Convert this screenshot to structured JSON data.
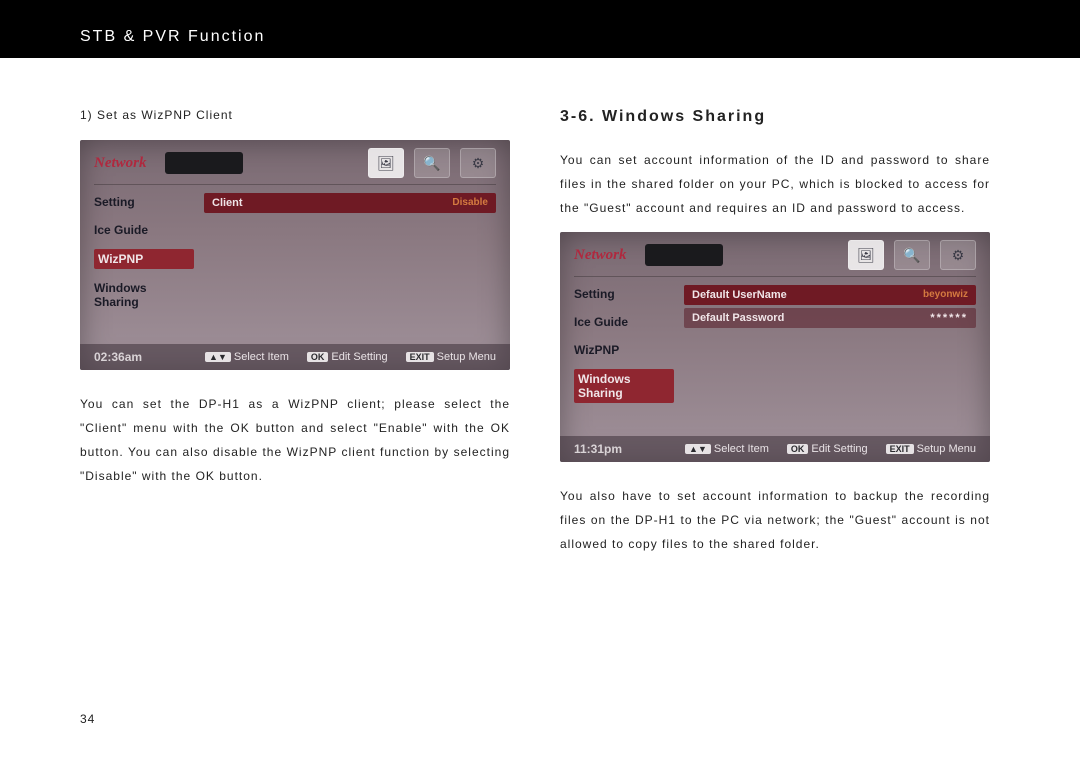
{
  "header": {
    "title": "STB & PVR Function"
  },
  "page_number": "34",
  "left": {
    "subhead": "1) Set as WizPNP Client",
    "body": "You can set the DP-H1 as a WizPNP client; please select the \"Client\" menu with the OK button and select \"Enable\" with the OK button. You can also disable the WizPNP client function by selecting \"Disable\" with the OK button.",
    "tv": {
      "logo": "Network",
      "sidebar": [
        "Setting",
        "Ice Guide",
        "WizPNP",
        "Windows Sharing"
      ],
      "selected_side_index": 2,
      "row": {
        "label": "Client",
        "value": "Disable"
      },
      "time": "02:36am",
      "footer": {
        "navkey": "▲▼",
        "nav": "Select Item",
        "okkey": "OK",
        "ok": "Edit Setting",
        "exitkey": "EXIT",
        "exit": "Setup Menu"
      }
    }
  },
  "right": {
    "title": "3-6. Windows Sharing",
    "intro": "You can set account information of the ID and password to share files in the shared folder on your PC, which is blocked to access for the \"Guest\" account and requires an ID and password to access.",
    "body": "You also have to set account information to backup the recording files on the DP-H1 to the PC via network; the \"Guest\" account is not allowed to copy files to the shared folder.",
    "tv": {
      "logo": "Network",
      "sidebar": [
        "Setting",
        "Ice Guide",
        "WizPNP",
        "Windows Sharing"
      ],
      "selected_side_index": 3,
      "rows": [
        {
          "label": "Default UserName",
          "value": "beyonwiz"
        },
        {
          "label": "Default Password",
          "mask": "******"
        }
      ],
      "time": "11:31pm",
      "footer": {
        "navkey": "▲▼",
        "nav": "Select Item",
        "okkey": "OK",
        "ok": "Edit Setting",
        "exitkey": "EXIT",
        "exit": "Setup Menu"
      }
    }
  }
}
